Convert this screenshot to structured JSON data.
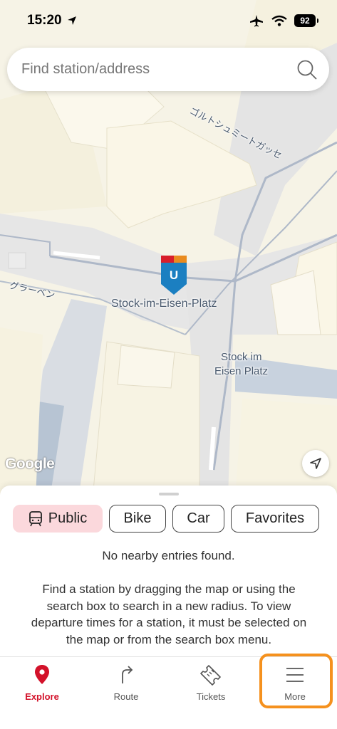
{
  "status_bar": {
    "time": "15:20",
    "battery": "92"
  },
  "search": {
    "placeholder": "Find station/address"
  },
  "map": {
    "street_label_1": "ゴルトシュミートガッセ",
    "street_label_2": "グラーベン",
    "station_marker_letter": "U",
    "station_name": "Stock-im-Eisen-Platz",
    "stop_label_line1": "Stock im",
    "stop_label_line2": "Eisen Platz",
    "attribution": "Google"
  },
  "filters": [
    {
      "label": "Public",
      "icon": "tram-icon",
      "active": true
    },
    {
      "label": "Bike",
      "active": false
    },
    {
      "label": "Car",
      "active": false
    },
    {
      "label": "Favorites",
      "active": false
    }
  ],
  "sheet": {
    "empty_message": "No nearby entries found.",
    "help_text": "Find a station by dragging the map or using the search box to search in a new radius. To view departure times for a station, it must be selected on the map or from the search box menu."
  },
  "tabs": [
    {
      "label": "Explore",
      "icon": "map-pin-icon",
      "active": true
    },
    {
      "label": "Route",
      "icon": "turn-arrow-icon",
      "active": false
    },
    {
      "label": "Tickets",
      "icon": "ticket-icon",
      "active": false
    },
    {
      "label": "More",
      "icon": "menu-icon",
      "active": false
    }
  ],
  "colors": {
    "accent": "#d3122a",
    "chip_active_bg": "#fbd8dc",
    "highlight": "#f5911e",
    "marker_blue": "#1b7fc1"
  }
}
